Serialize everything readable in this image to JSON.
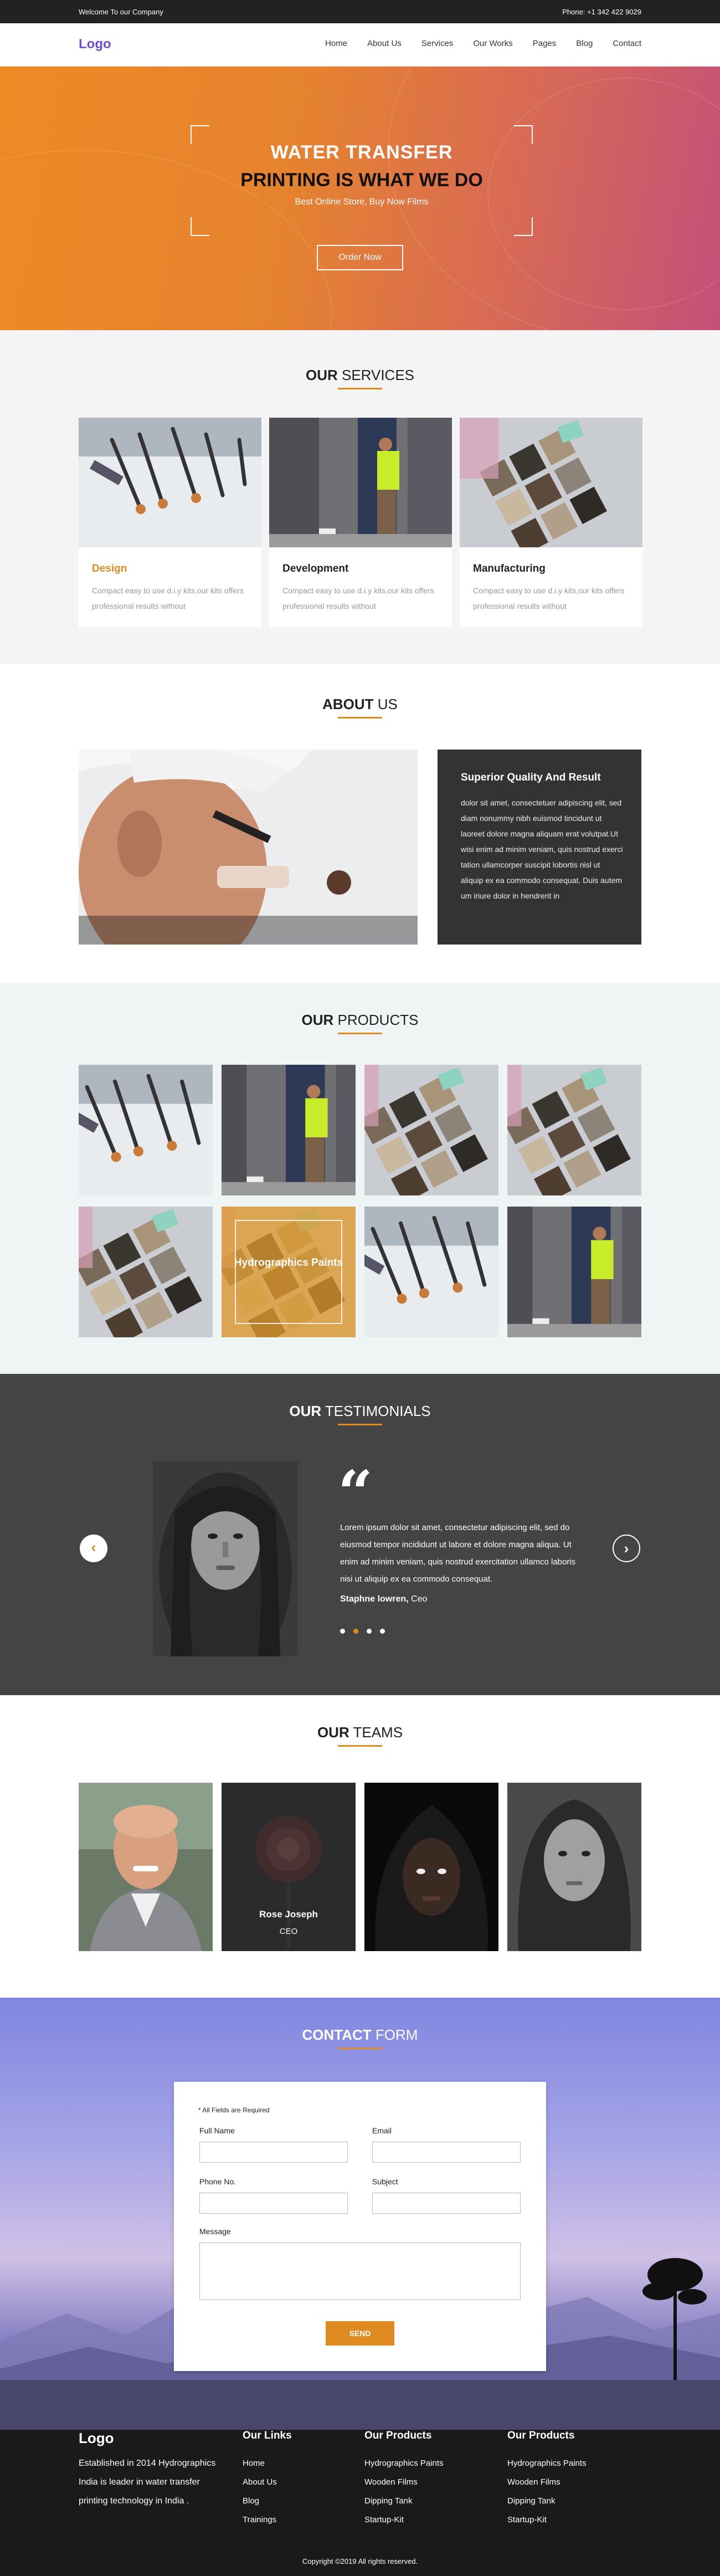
{
  "topbar": {
    "welcome": "Welcome To our Company",
    "phone": "Phone: +1 342 422 9029"
  },
  "nav": {
    "logo": "Logo",
    "items": [
      "Home",
      "About Us",
      "Services",
      "Our Works",
      "Pages",
      "Blog",
      "Contact"
    ]
  },
  "hero": {
    "line1": "WATER TRANSFER",
    "line2": "PRINTING IS WHAT WE DO",
    "subtitle": "Best Online Store, Buy Now Films",
    "button": "Order Now"
  },
  "services": {
    "title_bold": "OUR",
    "title_rest": "SERVICES",
    "cards": [
      {
        "title": "Design",
        "desc": "Compact easy to use d.i.y kits,our kits offers professional results without",
        "color": "#e08a22"
      },
      {
        "title": "Development",
        "desc": "Compact easy to use d.i.y kits,our kits offers professional results without",
        "color": "#222222"
      },
      {
        "title": "Manufacturing",
        "desc": "Compact easy to use d.i.y kits,our kits offers professional results without",
        "color": "#222222"
      }
    ]
  },
  "about": {
    "title_bold": "ABOUT",
    "title_rest": "US",
    "box_title": "Superior Quality And Result",
    "box_text": "dolor sit amet, consectetuer adipiscing elit, sed diam nonummy nibh euismod tincidunt ut laoreet dolore magna aliquam erat volutpat.Ut wisi enim ad minim veniam, quis nostrud exerci tation ullamcorper suscipit lobortis nisl ut aliquip ex ea commodo consequat. Duis autem um iriure dolor in hendrerit in"
  },
  "products": {
    "title_bold": "OUR",
    "title_rest": "PRODUCTS",
    "hover_label": "Hydrographics Paints"
  },
  "testimonials": {
    "title_bold": "OUR",
    "title_rest": "TESTIMONIALS",
    "quote_mark": "“",
    "text": "Lorem ipsum dolor sit amet, consectetur adipiscing elit, sed do eiusmod tempor incididunt ut labore et dolore magna aliqua. Ut enim ad minim veniam, quis nostrud exercitation ullamco laboris nisi ut aliquip ex ea commodo consequat.",
    "name": "Staphne lowren,",
    "role": "Ceo",
    "prev": "‹",
    "next": "›"
  },
  "teams": {
    "title_bold": "OUR",
    "title_rest": "TEAMS",
    "featured_name": "Rose Joseph",
    "featured_role": "CEO"
  },
  "contact": {
    "title_bold": "CONTACT",
    "title_rest": "FORM",
    "required_note": "* All Fields are Required",
    "labels": {
      "full_name": "Full Name",
      "email": "Email",
      "phone": "Phone No.",
      "subject": "Subject",
      "message": "Message"
    },
    "values": {
      "full_name": "",
      "email": "",
      "phone": "",
      "subject": "",
      "message": ""
    },
    "send": "SEND"
  },
  "footer": {
    "logo": "Logo",
    "about": "Established in 2014 Hydrographics India is leader in water transfer printing technology  in India .",
    "col1": {
      "heading": "Our Links",
      "items": [
        "Home",
        "About Us",
        "Blog",
        "Trainings"
      ]
    },
    "col2": {
      "heading": "Our Products",
      "items": [
        "Hydrographics Paints",
        "Wooden Films",
        "Dipping Tank",
        "Startup-Kit"
      ]
    },
    "col3": {
      "heading": "Our Products",
      "items": [
        "Hydrographics Paints",
        "Wooden Films",
        "Dipping Tank",
        "Startup-Kit"
      ]
    },
    "copyright": "Copyright ©2019 All rights reserved."
  },
  "colors": {
    "accent": "#e08a22",
    "brand": "#6a4fd3",
    "dark": "#333333",
    "testimonial_bg": "#444444"
  },
  "images": {
    "tools": "tools-photo",
    "worker": "worker-photo",
    "swatches": "swatches-photo",
    "about": "worker-closeup-photo"
  }
}
